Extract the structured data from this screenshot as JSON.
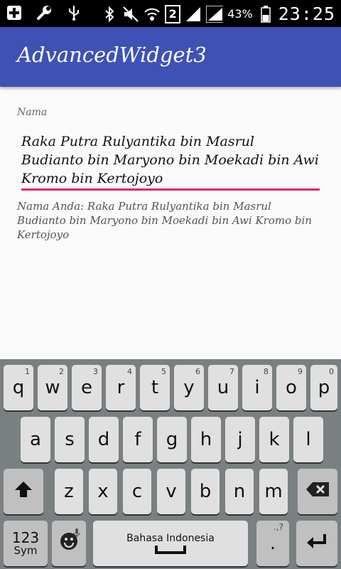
{
  "status_bar": {
    "battery_percent": "43%",
    "clock": "23:25",
    "sim_number": "2",
    "icons": [
      "plus-icon",
      "wrench-icon",
      "usb-icon",
      "bluetooth-icon",
      "mute-icon",
      "wifi-icon",
      "signal-icon",
      "signal-icon",
      "battery-icon"
    ]
  },
  "app_bar": {
    "title": "AdvancedWidget3",
    "color": "#3f51b5"
  },
  "form": {
    "name_label": "Nama",
    "name_value": "Raka Putra Rulyantika bin Masrul Budianto bin Maryono bin Moekadi bin Awi Kromo bin Kertojoyo",
    "echo_text": "Nama Anda: Raka Putra Rulyantika bin Masrul Budianto bin Maryono bin Moekadi bin Awi Kromo bin Kertojoyo",
    "accent_color": "#e91e63"
  },
  "keyboard": {
    "row1": [
      {
        "key": "q",
        "num": "1"
      },
      {
        "key": "w",
        "num": "2"
      },
      {
        "key": "e",
        "num": "3"
      },
      {
        "key": "r",
        "num": "4"
      },
      {
        "key": "t",
        "num": "5"
      },
      {
        "key": "y",
        "num": "6"
      },
      {
        "key": "u",
        "num": "7"
      },
      {
        "key": "i",
        "num": "8"
      },
      {
        "key": "o",
        "num": "9"
      },
      {
        "key": "p",
        "num": "0"
      }
    ],
    "row2": [
      "a",
      "s",
      "d",
      "f",
      "g",
      "h",
      "j",
      "k",
      "l"
    ],
    "row3": [
      "z",
      "x",
      "c",
      "v",
      "b",
      "n",
      "m"
    ],
    "sym_label": "123",
    "sym_sub": "Sym",
    "space_label": "Bahasa Indonesia",
    "period": ".",
    "shift_icon": "shift-icon",
    "backspace_icon": "backspace-icon",
    "emoji_icon": "emoji-icon",
    "enter_icon": "enter-icon"
  }
}
